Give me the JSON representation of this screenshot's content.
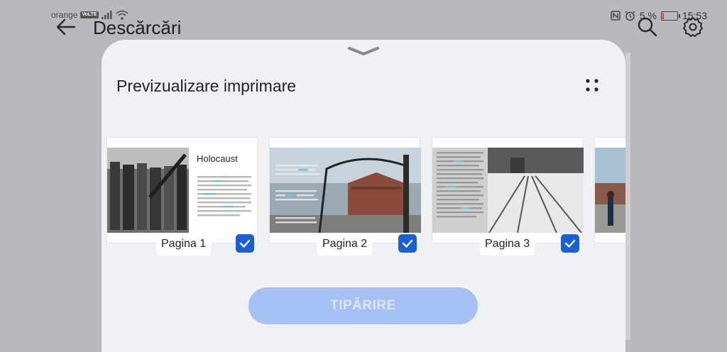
{
  "status_bar": {
    "carrier": "orange",
    "network_badge": "VoLTE",
    "battery_percent": "5 %",
    "battery_level": 0.05,
    "time": "15:53",
    "icons": [
      "signal-icon",
      "wifi-icon",
      "nfc-icon",
      "alarm-icon",
      "battery-icon"
    ]
  },
  "header": {
    "title": "Descărcări",
    "back_icon": "arrow-left-icon",
    "search_icon": "search-icon",
    "settings_icon": "gear-icon"
  },
  "sheet": {
    "title": "Previzualizare imprimare",
    "grip_icon": "chevron-down-icon",
    "grid_icon": "four-dots-icon",
    "pages": [
      {
        "label": "Pagina 1",
        "heading": "Holocaust",
        "checked": true
      },
      {
        "label": "Pagina 2",
        "checked": true
      },
      {
        "label": "Pagina 3",
        "checked": true
      },
      {
        "label": "",
        "checked": false
      }
    ],
    "print_button": "TIPĂRIRE"
  },
  "colors": {
    "accent": "#1a5fd8",
    "button_disabled": "#a5c0f4",
    "sheet_bg": "#f0f1f5",
    "backdrop": "#b9b9bd"
  }
}
